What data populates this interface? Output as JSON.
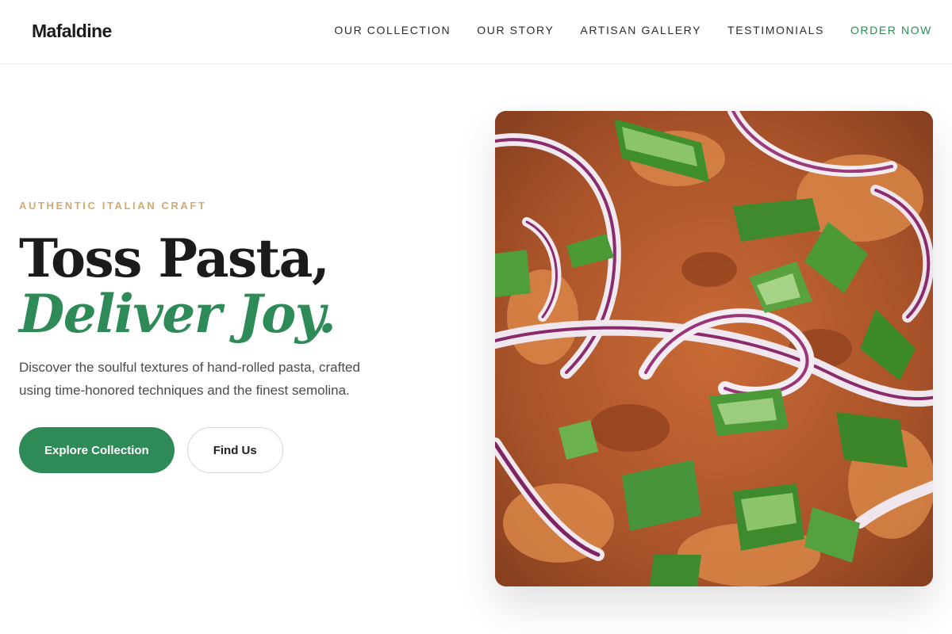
{
  "header": {
    "brand": "Mafaldine",
    "nav": [
      {
        "label": "OUR COLLECTION"
      },
      {
        "label": "OUR STORY"
      },
      {
        "label": "ARTISAN GALLERY"
      },
      {
        "label": "TESTIMONIALS"
      },
      {
        "label": "ORDER NOW"
      }
    ]
  },
  "hero": {
    "eyebrow": "AUTHENTIC ITALIAN CRAFT",
    "headline_line1": "Toss Pasta,",
    "headline_line2": "Deliver Joy.",
    "description": "Discover the soulful textures of hand-rolled pasta, crafted using time-honored techniques and the finest semolina.",
    "primary_button": "Explore Collection",
    "secondary_button": "Find Us"
  },
  "colors": {
    "accent": "#2e8b57",
    "eyebrow": "#d4aa72",
    "text": "#1b1b1b"
  }
}
